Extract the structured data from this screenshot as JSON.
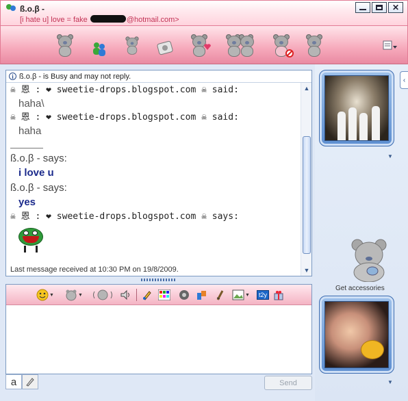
{
  "window": {
    "title": "ß.o.β  -",
    "subtitle_pre": "[i hate u] love = fake ",
    "subtitle_post": "@hotmail.com>",
    "controls": [
      "minimize",
      "maximize",
      "close"
    ]
  },
  "toolbar": {
    "icons": [
      "bear-icon",
      "contacts-icon",
      "bear-icon",
      "bear-icon",
      "bear-heart-icon",
      "bears-icon",
      "bear-block-icon",
      "bear-icon"
    ],
    "extra_icon": "menu-icon"
  },
  "status": {
    "text": "ß.o.β   - is Busy and may not reply."
  },
  "chat": {
    "messages": [
      {
        "kind": "mono",
        "text": "☠ 恩 : ❤ sweetie-drops.blogspot.com ☠ said:"
      },
      {
        "kind": "gray",
        "text": "haha\\"
      },
      {
        "kind": "mono",
        "text": "☠ 恩 : ❤ sweetie-drops.blogspot.com ☠ said:"
      },
      {
        "kind": "gray",
        "text": "haha"
      },
      {
        "kind": "says",
        "text": "ß.o.β  - says:"
      },
      {
        "kind": "blue",
        "text": "i love u"
      },
      {
        "kind": "says",
        "text": "ß.o.β  - says:"
      },
      {
        "kind": "blue",
        "text": "yes"
      },
      {
        "kind": "mono",
        "text": "☠ 恩 : ❤ sweetie-drops.blogspot.com ☠ says:"
      }
    ],
    "emoticon": "green-frog-emoticon",
    "last_received": "Last message received at 10:30 PM on 19/8/2009."
  },
  "input": {
    "toolbar_icons": [
      "emoticon-icon",
      "bear-wink-icon",
      "bear-nudge-icon",
      "voice-clip-icon",
      "pen-icon",
      "color-palette-icon",
      "sound-icon",
      "paint-icon",
      "handwriting-icon",
      "picture-icon",
      "t2y-icon",
      "gift-icon"
    ],
    "t2y_label": "t2y",
    "text": ""
  },
  "bottom": {
    "tab_text": "a",
    "send_label": "Send"
  },
  "sidebar": {
    "accessories_label": "Get accessories"
  },
  "colors": {
    "accent_pink": "#e98aa2",
    "frame_blue": "#5e8fd1",
    "text_blue": "#1b2a8c"
  }
}
